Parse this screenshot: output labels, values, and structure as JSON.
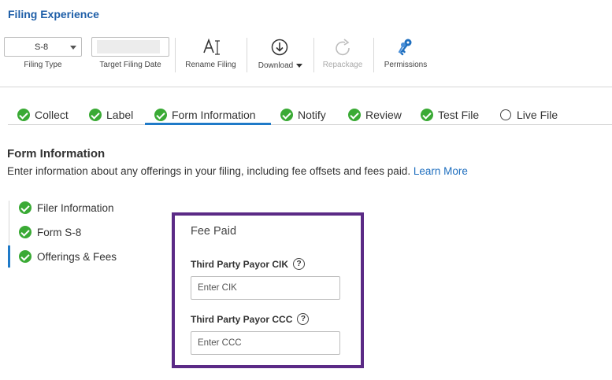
{
  "app": {
    "title": "Filing Experience"
  },
  "toolbar": {
    "filing_type": {
      "value": "S-8",
      "label": "Filing Type"
    },
    "target_date": {
      "label": "Target Filing Date"
    },
    "rename": {
      "label": "Rename Filing",
      "icon": "rename-text-icon"
    },
    "download": {
      "label": "Download",
      "icon": "download-icon"
    },
    "repackage": {
      "label": "Repackage",
      "icon": "refresh-icon",
      "disabled": true
    },
    "permissions": {
      "label": "Permissions",
      "icon": "keys-icon"
    }
  },
  "steps": [
    {
      "label": "Collect",
      "status": "complete"
    },
    {
      "label": "Label",
      "status": "complete"
    },
    {
      "label": "Form Information",
      "status": "complete",
      "active": true
    },
    {
      "label": "Notify",
      "status": "complete"
    },
    {
      "label": "Review",
      "status": "complete"
    },
    {
      "label": "Test File",
      "status": "complete"
    },
    {
      "label": "Live File",
      "status": "incomplete"
    }
  ],
  "section": {
    "title": "Form Information",
    "description": "Enter information about any offerings in your filing, including fee offsets and fees paid.",
    "link": "Learn More"
  },
  "subnav": [
    {
      "label": "Filer Information",
      "status": "complete"
    },
    {
      "label": "Form S-8",
      "status": "complete"
    },
    {
      "label": "Offerings & Fees",
      "status": "complete",
      "active": true
    }
  ],
  "fee_paid": {
    "title": "Fee Paid",
    "cik": {
      "label": "Third Party Payor CIK",
      "placeholder": "Enter CIK",
      "value": ""
    },
    "ccc": {
      "label": "Third Party Payor CCC",
      "placeholder": "Enter CCC",
      "value": ""
    }
  },
  "colors": {
    "brand_blue": "#1f5fa8",
    "link_blue": "#1f6fbf",
    "active_tab": "#1f7ac8",
    "success_green": "#3aaa35",
    "highlight_purple": "#5b2a86"
  }
}
